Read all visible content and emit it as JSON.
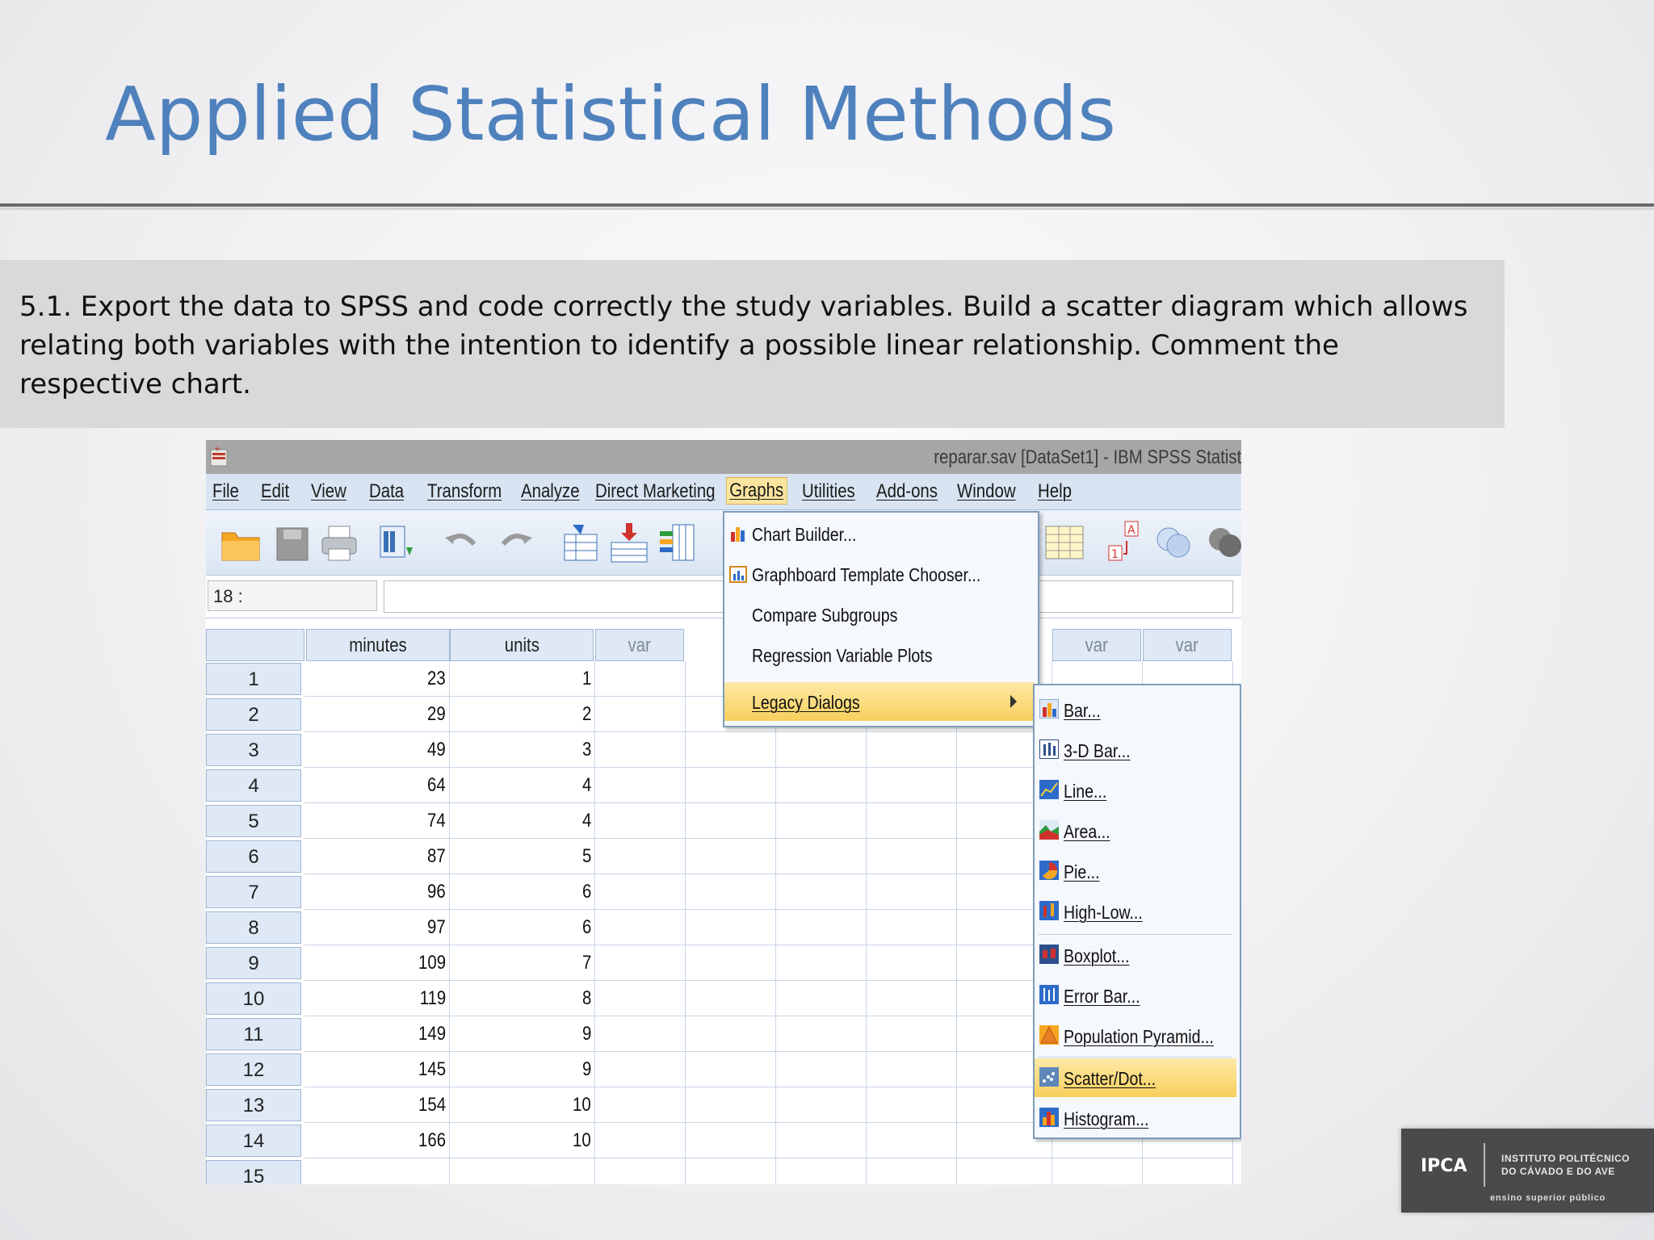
{
  "slide": {
    "title": "Applied Statistical Methods",
    "task": " 5.1. Export the data to SPSS and code correctly the study variables. Build a scatter diagram which allows relating both variables with the intention to identify a possible linear relationship. Comment the respective chart."
  },
  "spss": {
    "window_title": "reparar.sav [DataSet1] - IBM SPSS Statist",
    "menubar": [
      "File",
      "Edit",
      "View",
      "Data",
      "Transform",
      "Analyze",
      "Direct Marketing",
      "Graphs",
      "Utilities",
      "Add-ons",
      "Window",
      "Help"
    ],
    "active_menu": "Graphs",
    "cell_ref": "18 :",
    "columns": [
      "minutes",
      "units",
      "var",
      "var",
      "var"
    ],
    "rows": [
      {
        "n": "1",
        "minutes": "23",
        "units": "1"
      },
      {
        "n": "2",
        "minutes": "29",
        "units": "2"
      },
      {
        "n": "3",
        "minutes": "49",
        "units": "3"
      },
      {
        "n": "4",
        "minutes": "64",
        "units": "4"
      },
      {
        "n": "5",
        "minutes": "74",
        "units": "4"
      },
      {
        "n": "6",
        "minutes": "87",
        "units": "5"
      },
      {
        "n": "7",
        "minutes": "96",
        "units": "6"
      },
      {
        "n": "8",
        "minutes": "97",
        "units": "6"
      },
      {
        "n": "9",
        "minutes": "109",
        "units": "7"
      },
      {
        "n": "10",
        "minutes": "119",
        "units": "8"
      },
      {
        "n": "11",
        "minutes": "149",
        "units": "9"
      },
      {
        "n": "12",
        "minutes": "145",
        "units": "9"
      },
      {
        "n": "13",
        "minutes": "154",
        "units": "10"
      },
      {
        "n": "14",
        "minutes": "166",
        "units": "10"
      },
      {
        "n": "15",
        "minutes": "",
        "units": ""
      }
    ],
    "graphs_menu": [
      {
        "label": "Chart Builder...",
        "icon": "chart-builder-icon"
      },
      {
        "label": "Graphboard Template Chooser...",
        "icon": "graphboard-icon"
      },
      {
        "label": "Compare Subgroups",
        "icon": ""
      },
      {
        "label": "Regression Variable Plots",
        "icon": ""
      },
      {
        "label": "Legacy Dialogs",
        "icon": "",
        "highlighted": true,
        "submenu": true
      }
    ],
    "legacy_menu": [
      {
        "label": "Bar...",
        "icon": "bar-chart-icon"
      },
      {
        "label": "3-D Bar...",
        "icon": "3d-bar-icon"
      },
      {
        "label": "Line...",
        "icon": "line-chart-icon"
      },
      {
        "label": "Area...",
        "icon": "area-chart-icon"
      },
      {
        "label": "Pie...",
        "icon": "pie-chart-icon"
      },
      {
        "label": "High-Low...",
        "icon": "high-low-icon"
      },
      {
        "label": "Boxplot...",
        "icon": "boxplot-icon"
      },
      {
        "label": "Error Bar...",
        "icon": "error-bar-icon"
      },
      {
        "label": "Population Pyramid...",
        "icon": "pyramid-icon"
      },
      {
        "label": "Scatter/Dot...",
        "icon": "scatter-icon",
        "highlighted": true
      },
      {
        "label": "Histogram...",
        "icon": "histogram-icon"
      }
    ]
  },
  "logo": {
    "mark": "IPCA",
    "line1": "INSTITUTO POLITÉCNICO",
    "line2": "DO CÁVADO E DO AVE",
    "tagline": "ensino superior público"
  }
}
